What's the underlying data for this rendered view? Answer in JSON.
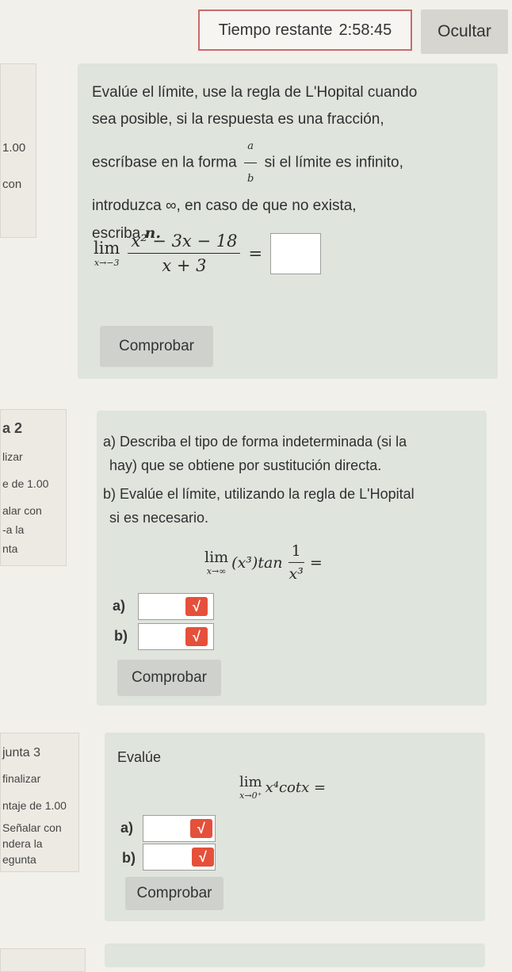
{
  "header": {
    "timer_label": "Tiempo restante",
    "timer_value": "2:58:45",
    "hide_button": "Ocultar"
  },
  "q1": {
    "side": {
      "points": "1.00",
      "flag": "con"
    },
    "instructions": [
      "Evalúe el límite, use la regla de L'Hopital cuando",
      "sea posible, si la respuesta es una fracción,",
      "escríbase en la forma",
      "si el límite es infinito,",
      "introduzca ∞, en caso de que no exista,",
      "escriba"
    ],
    "frac_num": "a",
    "frac_den": "b",
    "escriba_letter": "n.",
    "lim_word": "lim",
    "lim_sub": "x→−3",
    "numerator": "x² − 3x − 18",
    "denominator": "x + 3",
    "equals": "=",
    "check_button": "Comprobar"
  },
  "q2": {
    "side": {
      "number": "a 2",
      "line1": "lizar",
      "line2": "e de 1.00",
      "line3": "alar con",
      "line4": "-a la",
      "line5": "nta"
    },
    "part_a": "a) Describa el tipo de forma indeterminada (si la",
    "part_a2": "hay) que se obtiene por sustitución directa.",
    "part_b": "b) Evalúe el límite, utilizando la regla de L'Hopital",
    "part_b2": "si es necesario.",
    "lim_word": "lim",
    "lim_sub": "x→∞",
    "expr_base": "(x³)tan",
    "frac_num": "1",
    "frac_den": "x³",
    "equals": "=",
    "label_a": "a)",
    "label_b": "b)",
    "check_button": "Comprobar"
  },
  "q3": {
    "side": {
      "number": "junta 3",
      "line1": "finalizar",
      "line2": "ntaje de 1.00",
      "line3": "Señalar con",
      "line4": "ndera la",
      "line5": "egunta"
    },
    "title": "Evalúe",
    "lim_word": "lim",
    "lim_sub": "x→0⁺",
    "expr": "x⁴cotx =",
    "label_a": "a)",
    "label_b": "b)",
    "check_button": "Comprobar"
  },
  "icons": {
    "math_input": "sqrt-icon"
  },
  "colors": {
    "accent": "#e5503a",
    "timer_border": "#c96b6b",
    "card": "#dfe4dd"
  }
}
